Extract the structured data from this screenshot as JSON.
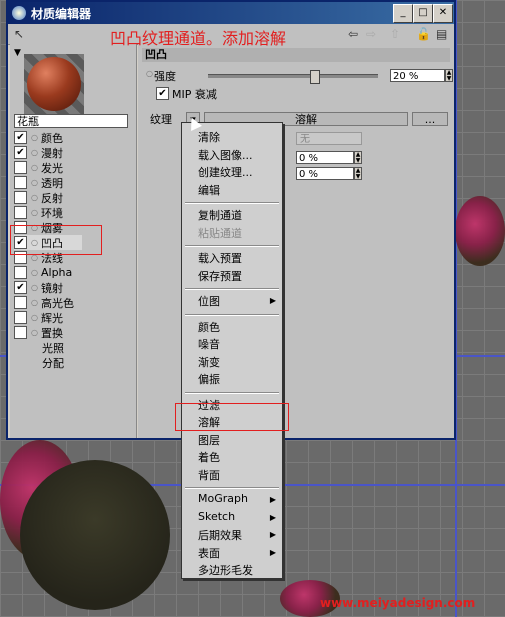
{
  "window": {
    "title": "材质编辑器"
  },
  "annotation": {
    "text": "凹凸纹理通道。添加溶解"
  },
  "material": {
    "name": "花瓶"
  },
  "channels": [
    {
      "label": "颜色",
      "checked": true
    },
    {
      "label": "漫射",
      "checked": true
    },
    {
      "label": "发光",
      "checked": false
    },
    {
      "label": "透明",
      "checked": false
    },
    {
      "label": "反射",
      "checked": false
    },
    {
      "label": "环境",
      "checked": false
    },
    {
      "label": "烟雾",
      "checked": false
    },
    {
      "label": "凹凸",
      "checked": true
    },
    {
      "label": "法线",
      "checked": false
    },
    {
      "label": "Alpha",
      "checked": false
    },
    {
      "label": "镜射",
      "checked": true
    },
    {
      "label": "高光色",
      "checked": false
    },
    {
      "label": "辉光",
      "checked": false
    },
    {
      "label": "置换",
      "checked": false
    },
    {
      "label": "光照",
      "checked": null
    },
    {
      "label": "分配",
      "checked": null
    }
  ],
  "bump": {
    "section_title": "凹凸",
    "strength_label": "强度",
    "strength_value": "20 %",
    "strength_fraction": 0.2,
    "mip_label": "MIP 衰减",
    "mip_checked": true,
    "texture_label": "纹理",
    "texture_value": "溶解",
    "more_label": "...",
    "mix_label": "无",
    "val1": "0 %",
    "val2": "0 %"
  },
  "menu": {
    "items": [
      "清除",
      "载入图像...",
      "创建纹理...",
      "编辑",
      "复制通道",
      "粘贴通道",
      "载入预置",
      "保存预置",
      "位图",
      "颜色",
      "噪音",
      "渐变",
      "偏振",
      "过滤",
      "溶解",
      "图层",
      "着色",
      "背面",
      "MoGraph",
      "Sketch",
      "后期效果",
      "表面",
      "多边形毛发"
    ],
    "disabled": [
      "粘贴通道"
    ],
    "submenu": [
      "位图",
      "MoGraph",
      "Sketch",
      "后期效果",
      "表面"
    ],
    "highlighted": "溶解"
  },
  "toolbar": {
    "icons": [
      "pointer-icon",
      "back-arrow-icon",
      "forward-arrow-icon",
      "up-arrow-icon",
      "lock-icon",
      "window-icon"
    ]
  },
  "watermark": "www.meiyadesign.com",
  "colors": {
    "annotation_red": "#e21f1f",
    "title_blue": "#0a246a"
  }
}
